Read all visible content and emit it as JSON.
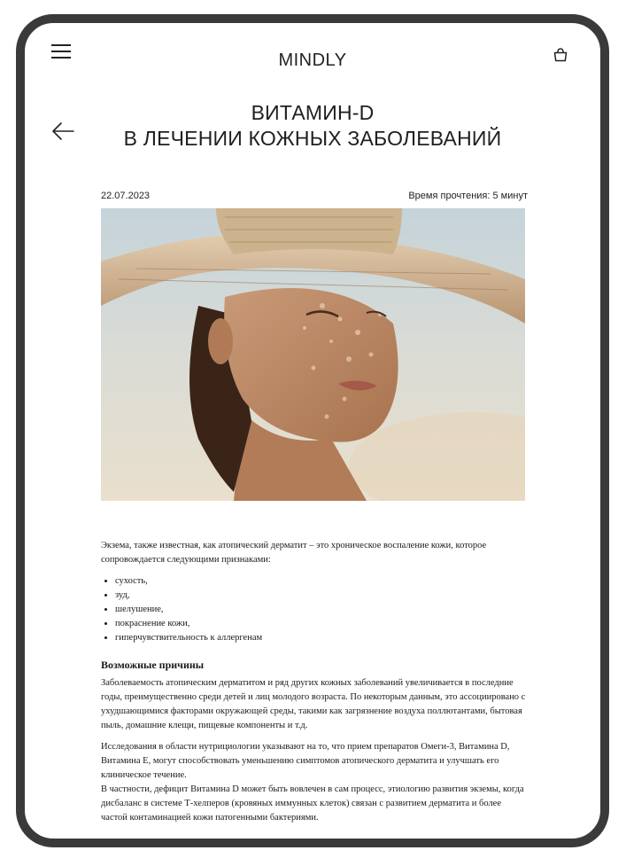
{
  "header": {
    "brand": "MINDLY"
  },
  "page": {
    "title_line1": "ВИТАМИН-D",
    "title_line2": "В ЛЕЧЕНИИ КОЖНЫХ ЗАБОЛЕВАНИЙ",
    "date": "22.07.2023",
    "read_time": "Время прочтения: 5 минут"
  },
  "article": {
    "intro": "Экзема, также известная, как атопический дерматит – это хроническое воспаление кожи, которое сопровождается следующими признаками:",
    "symptoms": [
      "сухость,",
      "зуд,",
      "шелушение,",
      "покраснение кожи,",
      "гиперчувствительность к аллергенам"
    ],
    "causes_heading": "Возможные причины",
    "para1": "Заболеваемость атопическим дерматитом и ряд других кожных заболеваний увеличивается в последние годы, преимущественно среди детей и лиц молодого возраста. По некоторым данным, это ассоциировано с ухудшающимися факторами окружающей среды, такими как загрязнение воздуха поллютантами, бытовая пыль, домашние клещи, пищевые компоненты и т.д.",
    "para2": "Исследования в области нутрициологии указывают на то, что прием препаратов Омеги-3, Витамина D, Витамина Е, могут способствовать уменьшению симптомов атопического дерматита и улучшать его клиническое течение.",
    "para3": "В частности, дефицит Витамина D может быть вовлечен в сам процесс, этиологию развития экземы, когда дисбаланс в системе Т-хелперов (кровяных иммунных клеток) связан с развитием дерматита и более частой контаминацией кожи патогенными бактериями."
  },
  "icons": {
    "menu": "hamburger-menu-icon",
    "bag": "shopping-bag-icon",
    "back": "back-arrow-icon"
  }
}
